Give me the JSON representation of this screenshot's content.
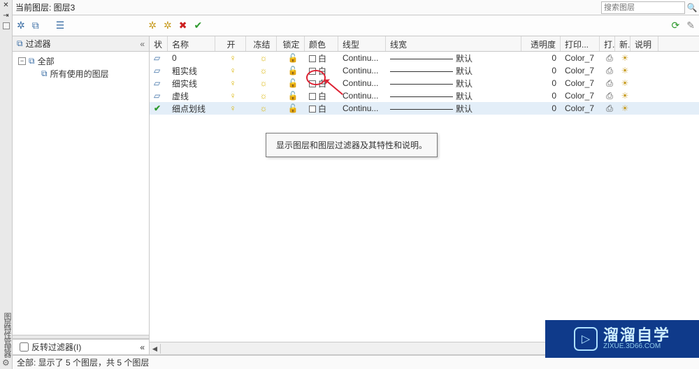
{
  "header": {
    "current_layer_label": "当前图层: 图层3",
    "search_placeholder": "搜索图层"
  },
  "filter": {
    "title": "过滤器",
    "collapse_glyph": "«",
    "tree": [
      {
        "label": "全部",
        "indent": 0,
        "toggle": "−"
      },
      {
        "label": "所有使用的图层",
        "indent": 1,
        "toggle": ""
      }
    ],
    "invert_label": "反转过滤器(I)"
  },
  "columns": {
    "status": "状",
    "name": "名称",
    "on": "开",
    "freeze": "冻结",
    "lock": "锁定",
    "color": "颜色",
    "ltype": "线型",
    "lweight": "线宽",
    "trans": "透明度",
    "pstyle": "打印...",
    "plot": "打.",
    "new": "新.",
    "desc": "说明"
  },
  "layers": [
    {
      "status": "layer",
      "name": "0",
      "on": true,
      "frozen": false,
      "locked": false,
      "color_name": "白",
      "ltype": "Continu...",
      "lweight": "默认",
      "trans": "0",
      "pstyle": "Color_7"
    },
    {
      "status": "layer",
      "name": "粗实线",
      "on": true,
      "frozen": false,
      "locked": false,
      "color_name": "白",
      "ltype": "Continu...",
      "lweight": "默认",
      "trans": "0",
      "pstyle": "Color_7"
    },
    {
      "status": "layer",
      "name": "细实线",
      "on": true,
      "frozen": false,
      "locked": false,
      "color_name": "白",
      "ltype": "Continu...",
      "lweight": "默认",
      "trans": "0",
      "pstyle": "Color_7"
    },
    {
      "status": "layer",
      "name": "虚线",
      "on": true,
      "frozen": false,
      "locked": false,
      "color_name": "白",
      "ltype": "Continu...",
      "lweight": "默认",
      "trans": "0",
      "pstyle": "Color_7"
    },
    {
      "status": "current",
      "name": "细点划线",
      "on": true,
      "frozen": false,
      "locked": false,
      "color_name": "白",
      "ltype": "Continu...",
      "lweight": "默认",
      "trans": "0",
      "pstyle": "Color_7",
      "selected": true
    }
  ],
  "tooltip": "显示图层和图层过滤器及其特性和说明。",
  "status_text": "全部: 显示了 5 个图层，共 5 个图层",
  "watermark": {
    "big": "溜溜自学",
    "small": "ZIXUE.3D66.COM"
  }
}
